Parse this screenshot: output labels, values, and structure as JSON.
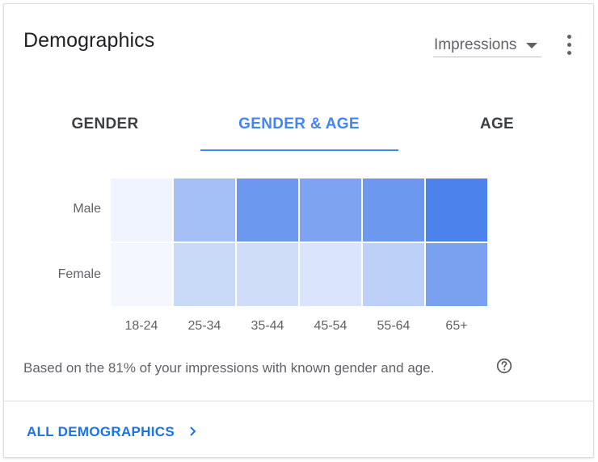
{
  "card": {
    "title": "Demographics",
    "metric_select": {
      "value": "Impressions"
    },
    "more_icon": "more-vert-icon"
  },
  "tabs": [
    {
      "label": "GENDER",
      "active": false
    },
    {
      "label": "GENDER & AGE",
      "active": true
    },
    {
      "label": "AGE",
      "active": false
    }
  ],
  "heatmap": {
    "rows": [
      "Male",
      "Female"
    ],
    "columns": [
      "18-24",
      "25-34",
      "35-44",
      "45-54",
      "55-64",
      "65+"
    ],
    "colors": [
      [
        "#f0f4fe",
        "#a4c0f6",
        "#6c98ef",
        "#7da3f1",
        "#6c98ef",
        "#4b82ec"
      ],
      [
        "#f4f7fe",
        "#c9daf9",
        "#cfddf8",
        "#dae5fb",
        "#bdd1f8",
        "#7aa1f0"
      ]
    ]
  },
  "note": "Based on the 81% of your impressions with known gender and age.",
  "help_icon": "help-circle-icon",
  "footer": {
    "link_label": "ALL DEMOGRAPHICS",
    "icon": "chevron-right-icon"
  },
  "colors": {
    "accent": "#4285f4",
    "link": "#1a73e8",
    "text_primary": "#202124",
    "text_secondary": "#5f6368",
    "divider": "#dadce0"
  }
}
